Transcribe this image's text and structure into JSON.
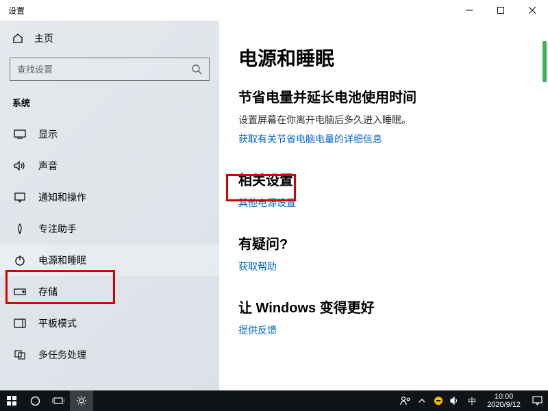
{
  "title": "设置",
  "home": "主页",
  "search_placeholder": "查找设置",
  "category": "系统",
  "nav": [
    {
      "label": "显示"
    },
    {
      "label": "声音"
    },
    {
      "label": "通知和操作"
    },
    {
      "label": "专注助手"
    },
    {
      "label": "电源和睡眠"
    },
    {
      "label": "存储"
    },
    {
      "label": "平板模式"
    },
    {
      "label": "多任务处理"
    }
  ],
  "content": {
    "heading": "电源和睡眠",
    "s1": {
      "title": "节省电量并延长电池使用时间",
      "desc": "设置屏幕在你离开电脑后多久进入睡眠。",
      "link": "获取有关节省电脑电量的详细信息"
    },
    "s2": {
      "title": "相关设置",
      "link": "其他电源设置"
    },
    "s3": {
      "title": "有疑问?",
      "link": "获取帮助"
    },
    "s4": {
      "title": "让 Windows 变得更好",
      "link": "提供反馈"
    }
  },
  "taskbar": {
    "ime": "中",
    "time": "10:00",
    "date": "2020/9/12"
  }
}
